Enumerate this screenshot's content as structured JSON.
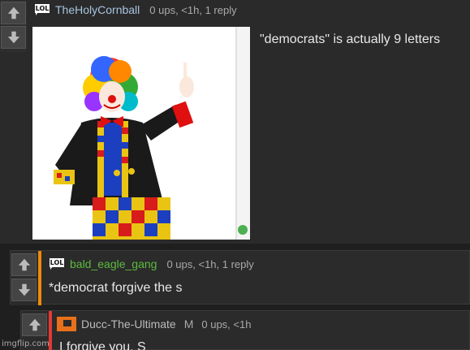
{
  "comments": [
    {
      "username": "TheHolyCornball",
      "username_color": "#a8c4e0",
      "meta": "0 ups, <1h, 1 reply",
      "text": "\"democrats\" is actually 9 letters",
      "icon": "lol-badge-icon",
      "image_icon": "clown-image"
    },
    {
      "username": "bald_eagle_gang",
      "username_color": "#5dbb3f",
      "meta": "0 ups, <1h, 1 reply",
      "text": "*democrat forgive the s",
      "icon": "lol-badge-icon",
      "bar_color": "#f0890c"
    },
    {
      "username": "Ducc-The-Ultimate",
      "username_color": "#bbbbbb",
      "flag": "M",
      "meta": "0 ups, <1h",
      "text": "I forgive you, S",
      "icon": "ducc-avatar-icon",
      "bar_color": "#e53935"
    }
  ],
  "vote": {
    "up_icon": "upvote-arrow-icon",
    "down_icon": "downvote-arrow-icon"
  },
  "watermark": "imgflip.com"
}
